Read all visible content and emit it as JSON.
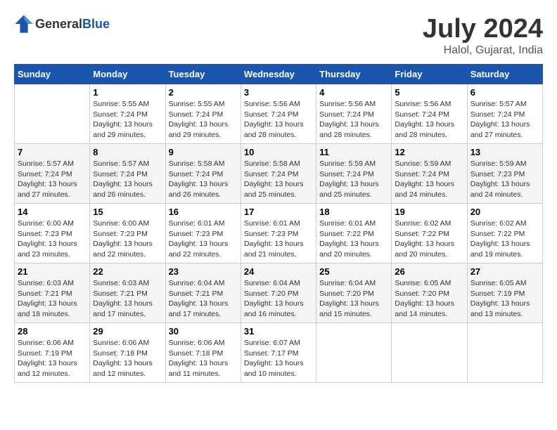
{
  "header": {
    "logo_general": "General",
    "logo_blue": "Blue",
    "month_year": "July 2024",
    "location": "Halol, Gujarat, India"
  },
  "days_of_week": [
    "Sunday",
    "Monday",
    "Tuesday",
    "Wednesday",
    "Thursday",
    "Friday",
    "Saturday"
  ],
  "weeks": [
    [
      {
        "day": "",
        "info": ""
      },
      {
        "day": "1",
        "info": "Sunrise: 5:55 AM\nSunset: 7:24 PM\nDaylight: 13 hours\nand 29 minutes."
      },
      {
        "day": "2",
        "info": "Sunrise: 5:55 AM\nSunset: 7:24 PM\nDaylight: 13 hours\nand 29 minutes."
      },
      {
        "day": "3",
        "info": "Sunrise: 5:56 AM\nSunset: 7:24 PM\nDaylight: 13 hours\nand 28 minutes."
      },
      {
        "day": "4",
        "info": "Sunrise: 5:56 AM\nSunset: 7:24 PM\nDaylight: 13 hours\nand 28 minutes."
      },
      {
        "day": "5",
        "info": "Sunrise: 5:56 AM\nSunset: 7:24 PM\nDaylight: 13 hours\nand 28 minutes."
      },
      {
        "day": "6",
        "info": "Sunrise: 5:57 AM\nSunset: 7:24 PM\nDaylight: 13 hours\nand 27 minutes."
      }
    ],
    [
      {
        "day": "7",
        "info": "Sunrise: 5:57 AM\nSunset: 7:24 PM\nDaylight: 13 hours\nand 27 minutes."
      },
      {
        "day": "8",
        "info": "Sunrise: 5:57 AM\nSunset: 7:24 PM\nDaylight: 13 hours\nand 26 minutes."
      },
      {
        "day": "9",
        "info": "Sunrise: 5:58 AM\nSunset: 7:24 PM\nDaylight: 13 hours\nand 26 minutes."
      },
      {
        "day": "10",
        "info": "Sunrise: 5:58 AM\nSunset: 7:24 PM\nDaylight: 13 hours\nand 25 minutes."
      },
      {
        "day": "11",
        "info": "Sunrise: 5:59 AM\nSunset: 7:24 PM\nDaylight: 13 hours\nand 25 minutes."
      },
      {
        "day": "12",
        "info": "Sunrise: 5:59 AM\nSunset: 7:24 PM\nDaylight: 13 hours\nand 24 minutes."
      },
      {
        "day": "13",
        "info": "Sunrise: 5:59 AM\nSunset: 7:23 PM\nDaylight: 13 hours\nand 24 minutes."
      }
    ],
    [
      {
        "day": "14",
        "info": "Sunrise: 6:00 AM\nSunset: 7:23 PM\nDaylight: 13 hours\nand 23 minutes."
      },
      {
        "day": "15",
        "info": "Sunrise: 6:00 AM\nSunset: 7:23 PM\nDaylight: 13 hours\nand 22 minutes."
      },
      {
        "day": "16",
        "info": "Sunrise: 6:01 AM\nSunset: 7:23 PM\nDaylight: 13 hours\nand 22 minutes."
      },
      {
        "day": "17",
        "info": "Sunrise: 6:01 AM\nSunset: 7:23 PM\nDaylight: 13 hours\nand 21 minutes."
      },
      {
        "day": "18",
        "info": "Sunrise: 6:01 AM\nSunset: 7:22 PM\nDaylight: 13 hours\nand 20 minutes."
      },
      {
        "day": "19",
        "info": "Sunrise: 6:02 AM\nSunset: 7:22 PM\nDaylight: 13 hours\nand 20 minutes."
      },
      {
        "day": "20",
        "info": "Sunrise: 6:02 AM\nSunset: 7:22 PM\nDaylight: 13 hours\nand 19 minutes."
      }
    ],
    [
      {
        "day": "21",
        "info": "Sunrise: 6:03 AM\nSunset: 7:21 PM\nDaylight: 13 hours\nand 18 minutes."
      },
      {
        "day": "22",
        "info": "Sunrise: 6:03 AM\nSunset: 7:21 PM\nDaylight: 13 hours\nand 17 minutes."
      },
      {
        "day": "23",
        "info": "Sunrise: 6:04 AM\nSunset: 7:21 PM\nDaylight: 13 hours\nand 17 minutes."
      },
      {
        "day": "24",
        "info": "Sunrise: 6:04 AM\nSunset: 7:20 PM\nDaylight: 13 hours\nand 16 minutes."
      },
      {
        "day": "25",
        "info": "Sunrise: 6:04 AM\nSunset: 7:20 PM\nDaylight: 13 hours\nand 15 minutes."
      },
      {
        "day": "26",
        "info": "Sunrise: 6:05 AM\nSunset: 7:20 PM\nDaylight: 13 hours\nand 14 minutes."
      },
      {
        "day": "27",
        "info": "Sunrise: 6:05 AM\nSunset: 7:19 PM\nDaylight: 13 hours\nand 13 minutes."
      }
    ],
    [
      {
        "day": "28",
        "info": "Sunrise: 6:06 AM\nSunset: 7:19 PM\nDaylight: 13 hours\nand 12 minutes."
      },
      {
        "day": "29",
        "info": "Sunrise: 6:06 AM\nSunset: 7:18 PM\nDaylight: 13 hours\nand 12 minutes."
      },
      {
        "day": "30",
        "info": "Sunrise: 6:06 AM\nSunset: 7:18 PM\nDaylight: 13 hours\nand 11 minutes."
      },
      {
        "day": "31",
        "info": "Sunrise: 6:07 AM\nSunset: 7:17 PM\nDaylight: 13 hours\nand 10 minutes."
      },
      {
        "day": "",
        "info": ""
      },
      {
        "day": "",
        "info": ""
      },
      {
        "day": "",
        "info": ""
      }
    ]
  ]
}
